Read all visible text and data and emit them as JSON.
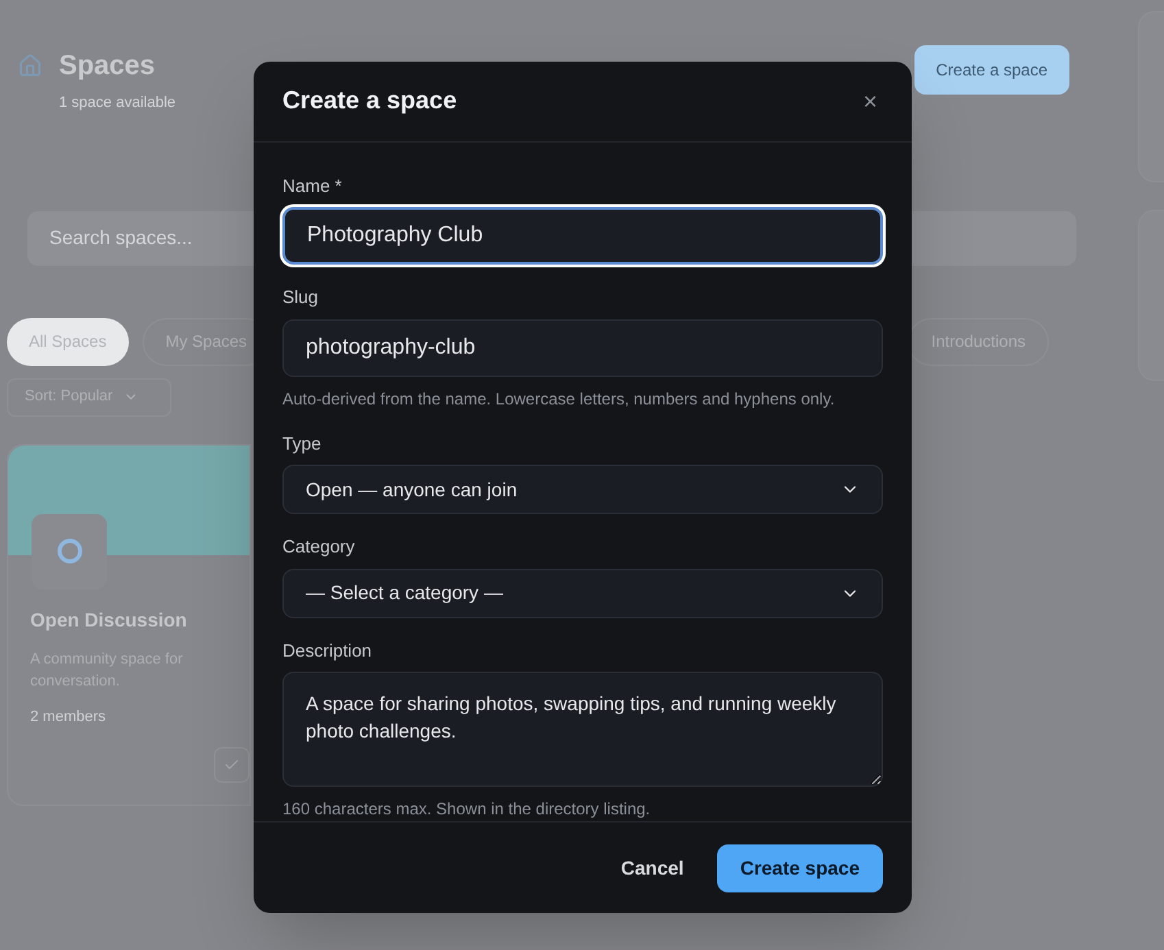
{
  "page": {
    "title": "Spaces",
    "subtitle": "1 space available",
    "create_button": "Create a space",
    "search": {
      "placeholder": "Search spaces..."
    },
    "filters": [
      {
        "label": "All Spaces",
        "selected": true
      },
      {
        "label": "My Spaces",
        "selected": false
      },
      {
        "label": "Introductions",
        "selected": false
      }
    ],
    "sort": "Sort: Popular",
    "card": {
      "title": "Open Discussion",
      "description_lines": [
        "A community space for",
        "conversation."
      ],
      "members": "2 members"
    }
  },
  "dialog": {
    "title": "Create a space",
    "close": "×",
    "fields": [
      {
        "kind": "text",
        "label": "Name *",
        "value": "Photography Club",
        "focused": true
      },
      {
        "kind": "text",
        "label": "Slug",
        "value": "photography-club",
        "focused": false,
        "hint": "Auto-derived from the name. Lowercase letters, numbers and hyphens only."
      },
      {
        "kind": "select",
        "label": "Type",
        "value": "Open — anyone can join",
        "focused": false
      },
      {
        "kind": "select",
        "label": "Category",
        "value": "— Select a category —",
        "focused": false
      },
      {
        "kind": "textarea",
        "label": "Description",
        "value": "A space for sharing photos, swapping tips, and running weekly photo challenges.",
        "focused": false,
        "hint": "160 characters max. Shown in the directory listing."
      }
    ],
    "cancel": "Cancel",
    "submit": "Create space"
  }
}
